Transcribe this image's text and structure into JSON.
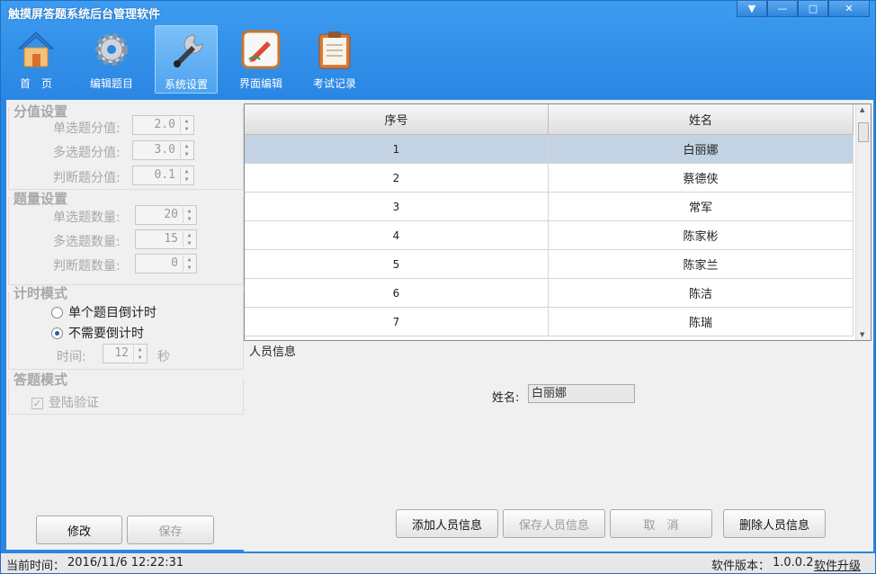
{
  "window": {
    "title": "触摸屏答题系统后台管理软件",
    "buttons": [
      "menu",
      "minimize",
      "maximize",
      "close"
    ]
  },
  "toolbar": [
    {
      "label": "首　页",
      "icon": "home-icon"
    },
    {
      "label": "编辑题目",
      "icon": "gear-icon"
    },
    {
      "label": "系统设置",
      "icon": "wrench-icon",
      "selected": true
    },
    {
      "label": "界面编辑",
      "icon": "edit-icon"
    },
    {
      "label": "考试记录",
      "icon": "clipboard-icon"
    }
  ],
  "score": {
    "title": "分值设置",
    "single_label": "单选题分值:",
    "single_value": "2.0",
    "multi_label": "多选题分值:",
    "multi_value": "3.0",
    "judge_label": "判断题分值:",
    "judge_value": "0.1"
  },
  "count": {
    "title": "题量设置",
    "single_label": "单选题数量:",
    "single_value": "20",
    "multi_label": "多选题数量:",
    "multi_value": "15",
    "judge_label": "判断题数量:",
    "judge_value": "0"
  },
  "timer": {
    "title": "计时模式",
    "opt1": "单个题目倒计时",
    "opt2": "不需要倒计时",
    "selected": "opt2",
    "time_label": "时间:",
    "time_value": "12",
    "unit": "秒"
  },
  "answer": {
    "title": "答题模式",
    "login_label": "登陆验证",
    "login_checked": true
  },
  "left_buttons": {
    "modify": "修改",
    "save": "保存"
  },
  "table": {
    "headers": [
      "序号",
      "姓名"
    ],
    "rows": [
      [
        "1",
        "白丽娜"
      ],
      [
        "2",
        "蔡德侠"
      ],
      [
        "3",
        "常军"
      ],
      [
        "4",
        "陈家彬"
      ],
      [
        "5",
        "陈家兰"
      ],
      [
        "6",
        "陈洁"
      ],
      [
        "7",
        "陈瑞"
      ]
    ],
    "selected_row": 0
  },
  "info": {
    "title": "人员信息",
    "name_label": "姓名:",
    "name_value": "白丽娜"
  },
  "right_buttons": {
    "add": "添加人员信息",
    "save": "保存人员信息",
    "cancel": "取　消",
    "delete": "删除人员信息"
  },
  "status": {
    "time_label": "当前时间：",
    "time_value": "2016/11/6 12:22:31",
    "version_label": "软件版本：",
    "version_value": "1.0.0.2",
    "upgrade": "软件升级"
  }
}
